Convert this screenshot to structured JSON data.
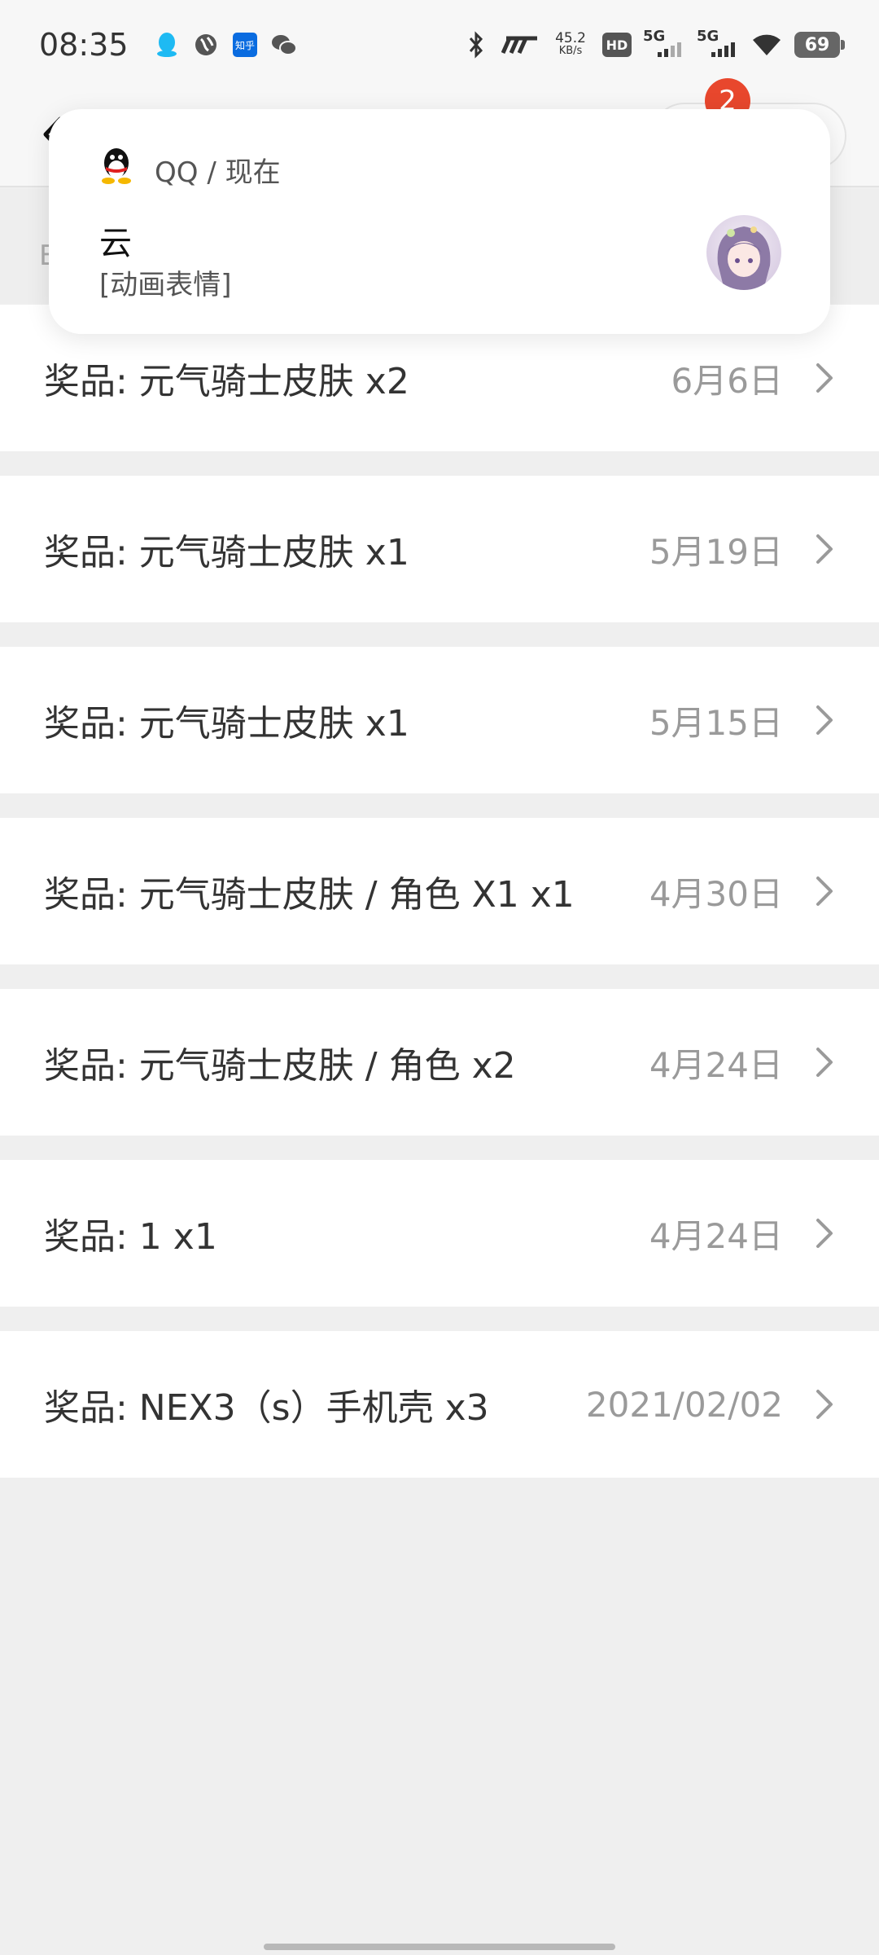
{
  "status_bar": {
    "time": "08:35",
    "net_speed_value": "45.2",
    "net_speed_unit": "KB/s",
    "hd_label": "HD",
    "sim1_label": "5G",
    "sim2_label": "5G",
    "battery": "69",
    "left_icons": [
      "qq-icon",
      "browser-icon",
      "zhihu-icon",
      "wechat-icon"
    ],
    "zhihu_label": "知乎"
  },
  "header": {
    "badge_count": "2",
    "subheader_text": "E"
  },
  "notification": {
    "app_line": "QQ / 现在",
    "title": "云",
    "body": "[动画表情]"
  },
  "records": [
    {
      "label": "奖品: 元气骑士皮肤  x2",
      "date": "6月6日"
    },
    {
      "label": "奖品: 元气骑士皮肤  x1",
      "date": "5月19日"
    },
    {
      "label": "奖品: 元气骑士皮肤  x1",
      "date": "5月15日"
    },
    {
      "label": "奖品: 元气骑士皮肤 / 角色 X1  x1",
      "date": "4月30日"
    },
    {
      "label": "奖品: 元气骑士皮肤 / 角色  x2",
      "date": "4月24日"
    },
    {
      "label": "奖品: 1  x1",
      "date": "4月24日"
    },
    {
      "label": "奖品: NEX3（s）手机壳  x3",
      "date": "2021/02/02"
    }
  ],
  "colors": {
    "accent_badge": "#e8472d",
    "background": "#efefef",
    "row_bg": "#ffffff",
    "date_text": "#9a9a9a"
  }
}
